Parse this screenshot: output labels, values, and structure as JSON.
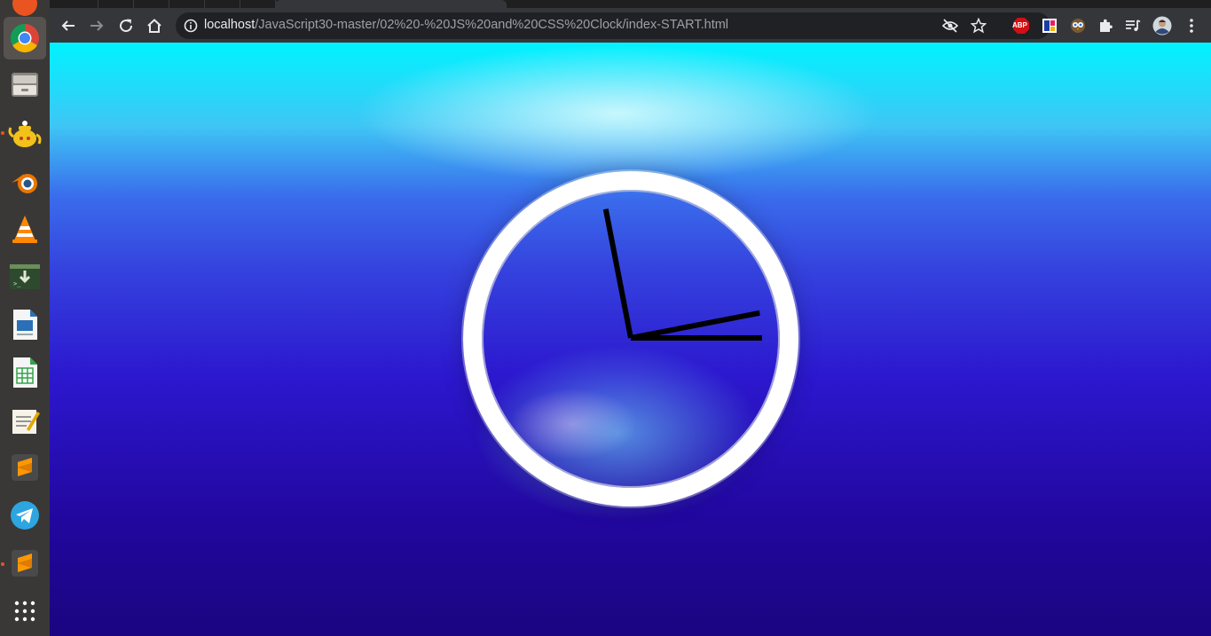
{
  "browser": {
    "url_host": "localhost",
    "url_path": "/JavaScript30-master/02%20-%20JS%20and%20CSS%20Clock/index-START.html",
    "extension_labels": {
      "adblock": "ABP"
    }
  },
  "dock": {
    "apps": [
      {
        "name": "chrome",
        "active": true
      },
      {
        "name": "files"
      },
      {
        "name": "teapot"
      },
      {
        "name": "blender"
      },
      {
        "name": "vlc"
      },
      {
        "name": "terminal-install"
      },
      {
        "name": "libreoffice-writer"
      },
      {
        "name": "libreoffice-calc"
      },
      {
        "name": "text-editor"
      },
      {
        "name": "sublime-text"
      },
      {
        "name": "telegram"
      },
      {
        "name": "sublime-text-2"
      },
      {
        "name": "show-applications"
      }
    ]
  },
  "clock": {
    "hour_hand_angle_deg": 0,
    "minute_hand_angle_deg": -11,
    "second_hand_angle_deg": 0,
    "minute_hand_color": "#000000",
    "hour_hand_color": "#000000",
    "second_hand_color": "#000000"
  },
  "colors": {
    "toolbar": "#35363a",
    "omnibox": "#202124",
    "water_top": "#00f3ff",
    "water_bottom": "#1b0580"
  }
}
